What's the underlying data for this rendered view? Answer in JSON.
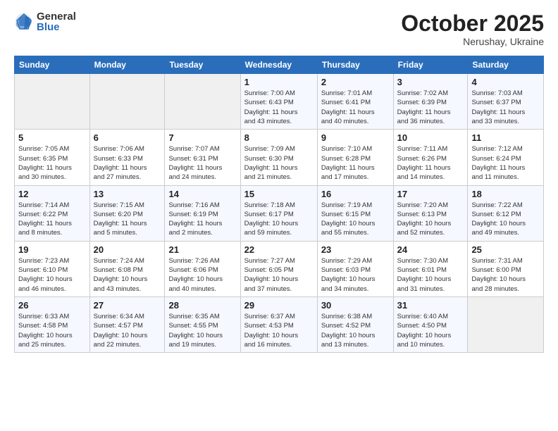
{
  "logo": {
    "general": "General",
    "blue": "Blue"
  },
  "header": {
    "month": "October 2025",
    "location": "Nerushay, Ukraine"
  },
  "weekdays": [
    "Sunday",
    "Monday",
    "Tuesday",
    "Wednesday",
    "Thursday",
    "Friday",
    "Saturday"
  ],
  "weeks": [
    [
      {
        "day": "",
        "info": ""
      },
      {
        "day": "",
        "info": ""
      },
      {
        "day": "",
        "info": ""
      },
      {
        "day": "1",
        "info": "Sunrise: 7:00 AM\nSunset: 6:43 PM\nDaylight: 11 hours\nand 43 minutes."
      },
      {
        "day": "2",
        "info": "Sunrise: 7:01 AM\nSunset: 6:41 PM\nDaylight: 11 hours\nand 40 minutes."
      },
      {
        "day": "3",
        "info": "Sunrise: 7:02 AM\nSunset: 6:39 PM\nDaylight: 11 hours\nand 36 minutes."
      },
      {
        "day": "4",
        "info": "Sunrise: 7:03 AM\nSunset: 6:37 PM\nDaylight: 11 hours\nand 33 minutes."
      }
    ],
    [
      {
        "day": "5",
        "info": "Sunrise: 7:05 AM\nSunset: 6:35 PM\nDaylight: 11 hours\nand 30 minutes."
      },
      {
        "day": "6",
        "info": "Sunrise: 7:06 AM\nSunset: 6:33 PM\nDaylight: 11 hours\nand 27 minutes."
      },
      {
        "day": "7",
        "info": "Sunrise: 7:07 AM\nSunset: 6:31 PM\nDaylight: 11 hours\nand 24 minutes."
      },
      {
        "day": "8",
        "info": "Sunrise: 7:09 AM\nSunset: 6:30 PM\nDaylight: 11 hours\nand 21 minutes."
      },
      {
        "day": "9",
        "info": "Sunrise: 7:10 AM\nSunset: 6:28 PM\nDaylight: 11 hours\nand 17 minutes."
      },
      {
        "day": "10",
        "info": "Sunrise: 7:11 AM\nSunset: 6:26 PM\nDaylight: 11 hours\nand 14 minutes."
      },
      {
        "day": "11",
        "info": "Sunrise: 7:12 AM\nSunset: 6:24 PM\nDaylight: 11 hours\nand 11 minutes."
      }
    ],
    [
      {
        "day": "12",
        "info": "Sunrise: 7:14 AM\nSunset: 6:22 PM\nDaylight: 11 hours\nand 8 minutes."
      },
      {
        "day": "13",
        "info": "Sunrise: 7:15 AM\nSunset: 6:20 PM\nDaylight: 11 hours\nand 5 minutes."
      },
      {
        "day": "14",
        "info": "Sunrise: 7:16 AM\nSunset: 6:19 PM\nDaylight: 11 hours\nand 2 minutes."
      },
      {
        "day": "15",
        "info": "Sunrise: 7:18 AM\nSunset: 6:17 PM\nDaylight: 10 hours\nand 59 minutes."
      },
      {
        "day": "16",
        "info": "Sunrise: 7:19 AM\nSunset: 6:15 PM\nDaylight: 10 hours\nand 55 minutes."
      },
      {
        "day": "17",
        "info": "Sunrise: 7:20 AM\nSunset: 6:13 PM\nDaylight: 10 hours\nand 52 minutes."
      },
      {
        "day": "18",
        "info": "Sunrise: 7:22 AM\nSunset: 6:12 PM\nDaylight: 10 hours\nand 49 minutes."
      }
    ],
    [
      {
        "day": "19",
        "info": "Sunrise: 7:23 AM\nSunset: 6:10 PM\nDaylight: 10 hours\nand 46 minutes."
      },
      {
        "day": "20",
        "info": "Sunrise: 7:24 AM\nSunset: 6:08 PM\nDaylight: 10 hours\nand 43 minutes."
      },
      {
        "day": "21",
        "info": "Sunrise: 7:26 AM\nSunset: 6:06 PM\nDaylight: 10 hours\nand 40 minutes."
      },
      {
        "day": "22",
        "info": "Sunrise: 7:27 AM\nSunset: 6:05 PM\nDaylight: 10 hours\nand 37 minutes."
      },
      {
        "day": "23",
        "info": "Sunrise: 7:29 AM\nSunset: 6:03 PM\nDaylight: 10 hours\nand 34 minutes."
      },
      {
        "day": "24",
        "info": "Sunrise: 7:30 AM\nSunset: 6:01 PM\nDaylight: 10 hours\nand 31 minutes."
      },
      {
        "day": "25",
        "info": "Sunrise: 7:31 AM\nSunset: 6:00 PM\nDaylight: 10 hours\nand 28 minutes."
      }
    ],
    [
      {
        "day": "26",
        "info": "Sunrise: 6:33 AM\nSunset: 4:58 PM\nDaylight: 10 hours\nand 25 minutes."
      },
      {
        "day": "27",
        "info": "Sunrise: 6:34 AM\nSunset: 4:57 PM\nDaylight: 10 hours\nand 22 minutes."
      },
      {
        "day": "28",
        "info": "Sunrise: 6:35 AM\nSunset: 4:55 PM\nDaylight: 10 hours\nand 19 minutes."
      },
      {
        "day": "29",
        "info": "Sunrise: 6:37 AM\nSunset: 4:53 PM\nDaylight: 10 hours\nand 16 minutes."
      },
      {
        "day": "30",
        "info": "Sunrise: 6:38 AM\nSunset: 4:52 PM\nDaylight: 10 hours\nand 13 minutes."
      },
      {
        "day": "31",
        "info": "Sunrise: 6:40 AM\nSunset: 4:50 PM\nDaylight: 10 hours\nand 10 minutes."
      },
      {
        "day": "",
        "info": ""
      }
    ]
  ]
}
